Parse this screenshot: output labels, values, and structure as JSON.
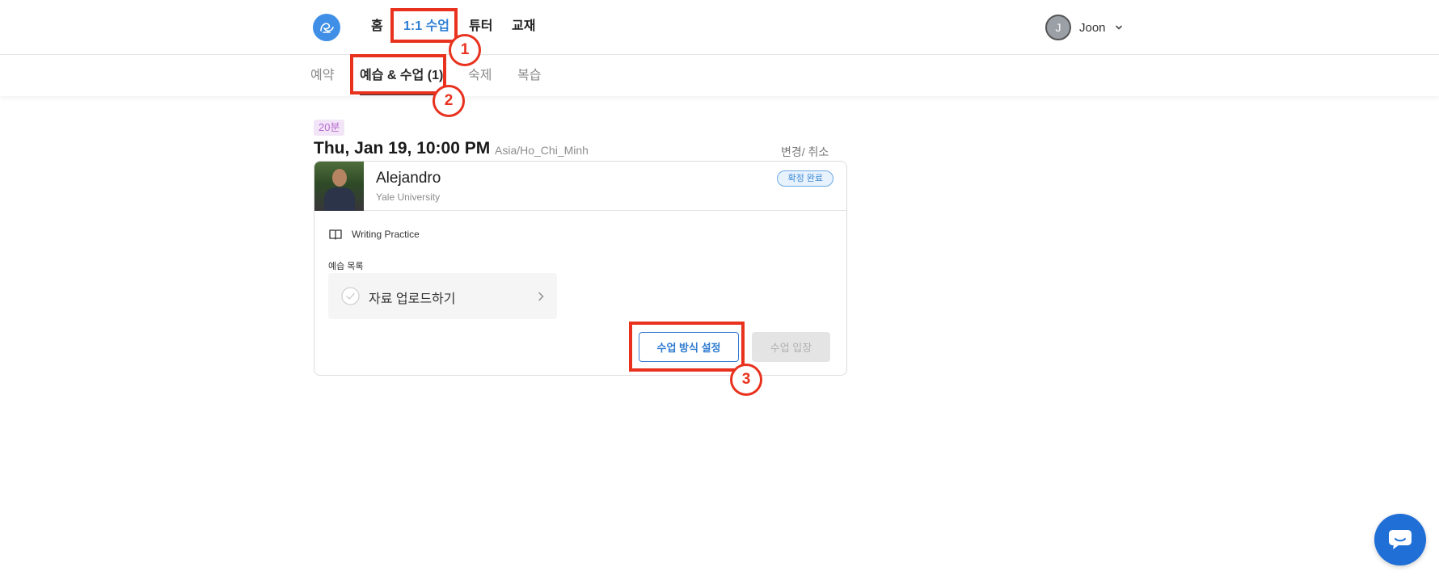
{
  "nav": {
    "items": [
      {
        "label": "홈"
      },
      {
        "label": "1:1 수업"
      },
      {
        "label": "튜터"
      },
      {
        "label": "교재"
      }
    ],
    "user": {
      "initial": "J",
      "name": "Joon"
    }
  },
  "subtabs": [
    {
      "label": "예약"
    },
    {
      "label": "예습 & 수업 (1)"
    },
    {
      "label": "숙제"
    },
    {
      "label": "복습"
    }
  ],
  "lesson": {
    "duration": "20분",
    "date": "Thu, Jan 19, 10:00 PM",
    "timezone": "Asia/Ho_Chi_Minh",
    "change_label": "변경/ 취소",
    "tutor": {
      "name": "Alejandro",
      "school": "Yale University"
    },
    "status": "확정 완료",
    "material": "Writing Practice",
    "prep_label": "예습 목록",
    "prep_items": [
      {
        "label": "자료 업로드하기"
      }
    ],
    "buttons": {
      "method": "수업 방식 설정",
      "enter": "수업 입장"
    }
  },
  "annotations": [
    "1",
    "2",
    "3"
  ],
  "colors": {
    "accent": "#2f7fd6",
    "annotation": "#e8321e",
    "chat": "#1f6fd6",
    "badge_purple": "#b46ad0"
  },
  "icons": [
    "logo-icon",
    "chevron-down-icon",
    "book-icon",
    "check-circle-icon",
    "chevron-right-icon",
    "chat-icon"
  ]
}
